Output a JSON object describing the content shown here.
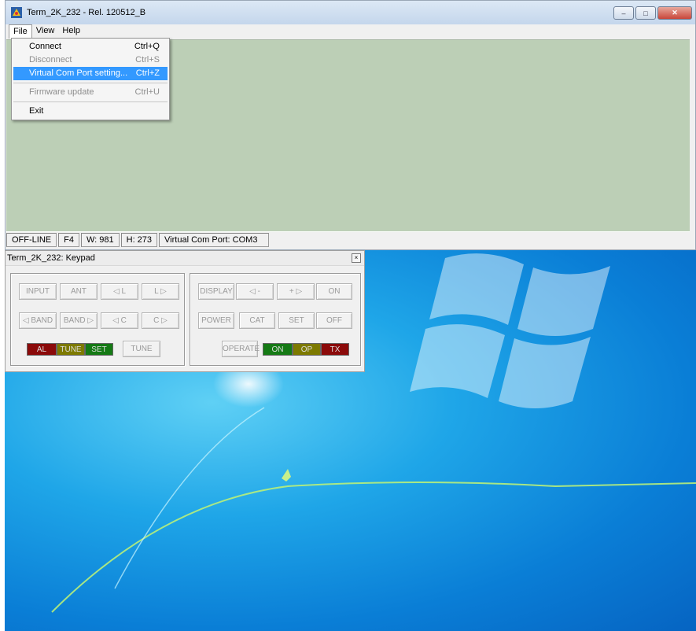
{
  "main_window": {
    "title": "Term_2K_232 - Rel. 120512_B",
    "controls": {
      "minimize": "–",
      "maximize": "□",
      "close": "✕"
    },
    "menu": [
      "File",
      "View",
      "Help"
    ]
  },
  "file_menu": {
    "items": [
      {
        "label": "Connect",
        "shortcut": "Ctrl+Q"
      },
      {
        "label": "Disconnect",
        "shortcut": "Ctrl+S"
      },
      {
        "label": "Virtual Com Port setting...",
        "shortcut": "Ctrl+Z"
      },
      {
        "label": "Firmware update",
        "shortcut": "Ctrl+U"
      },
      {
        "label": "Exit",
        "shortcut": ""
      }
    ]
  },
  "statusbar": {
    "state": "OFF-LINE",
    "font": "F4",
    "width": "W: 981",
    "height": "H: 273",
    "port": "Virtual Com Port: COM3"
  },
  "keypad": {
    "title": "Term_2K_232: Keypad",
    "close": "×",
    "left": {
      "input": "INPUT",
      "ant": "ANT",
      "l_left": "◁ L",
      "l_right": "L ▷",
      "band_left": "◁ BAND",
      "band_right": "BAND ▷",
      "c_left": "◁ C",
      "c_right": "C ▷",
      "tune": "TUNE",
      "ind_al": "AL",
      "ind_tune": "TUNE",
      "ind_set": "SET"
    },
    "right": {
      "display": "DISPLAY",
      "minus": "◁ -",
      "plus": "+ ▷",
      "on": "ON",
      "power": "POWER",
      "cat": "CAT",
      "set": "SET",
      "off": "OFF",
      "operate": "OPERATE",
      "ind_on": "ON",
      "ind_op": "OP",
      "ind_tx": "TX"
    }
  },
  "colors": {
    "client_bg": "#bccfb6",
    "menu_highlight": "#3399ff",
    "ind_red": "#8b0a0a",
    "ind_olive": "#7d7a00",
    "ind_green": "#157a15"
  }
}
